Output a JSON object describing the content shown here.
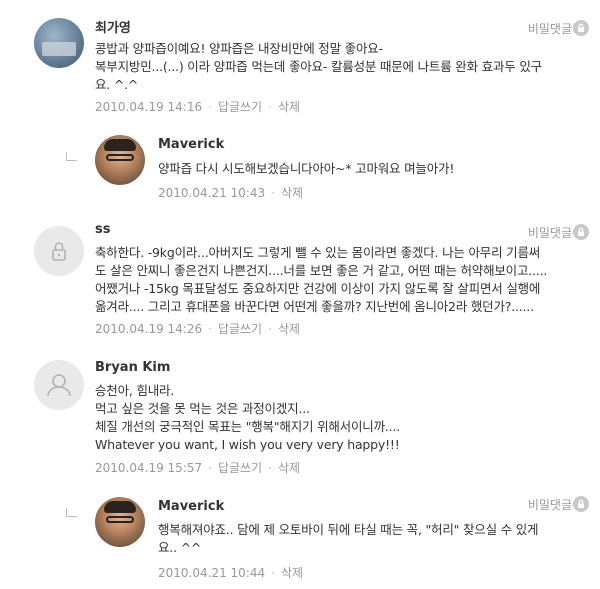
{
  "comments": [
    {
      "author": "최가영",
      "text": "콩밥과 양파즙이예요! 양파즙은 내장비만에 정말 좋아요-\n복부지방민...(...) 이라 양파즙 먹는데 좋아요- 칼륨성분 때문에 나트륨 완화 효과두 있구\n요. ^.^",
      "date": "2010.04.19 14:16",
      "reply_label": "답글쓰기",
      "delete_label": "삭제",
      "secret_label": "비밀댓글"
    },
    {
      "author": "Maverick",
      "text": "양파즙 다시 시도해보겠습니다아아~* 고마워요 며늘아가!",
      "date": "2010.04.21 10:43",
      "delete_label": "삭제"
    },
    {
      "author": "ss",
      "text": "축하한다. -9kg이라...아버지도 그렇게 뺄 수 있는 몸이라면 좋겠다. 나는 아무리 기름써\n도 살은 안찌니 좋은건지 나쁜건지....너를 보면 좋은 거 같고, 어떤 때는 허약해보이고.....\n어쨌거나 -15kg 목표달성도 중요하지만 건강에 이상이 가지 않도록 잘 살피면서 실행에\n옮겨라.... 그리고 휴대폰을 바꾼다면 어떤게 좋을까? 지난번에 옴니아2라 했던가?......",
      "date": "2010.04.19 14:26",
      "reply_label": "답글쓰기",
      "delete_label": "삭제",
      "secret_label": "비밀댓글"
    },
    {
      "author": "Bryan Kim",
      "text": "승천아, 힘내라.\n먹고 싶은 것을 못 먹는 것은 과정이겠지...\n체질 개선의 궁극적인 목표는 \"행복\"해지기 위해서이니까....\nWhatever you want, I wish you very very happy!!!",
      "date": "2010.04.19 15:57",
      "reply_label": "답글쓰기",
      "delete_label": "삭제"
    },
    {
      "author": "Maverick",
      "text": "행복해져야죠.. 담에 제 오토바이 뒤에 타실 때는 꼭, \"허리\" 찾으실 수 있게\n요.. ^^",
      "date": "2010.04.21 10:44",
      "delete_label": "삭제",
      "secret_label": "비밀댓글"
    }
  ]
}
